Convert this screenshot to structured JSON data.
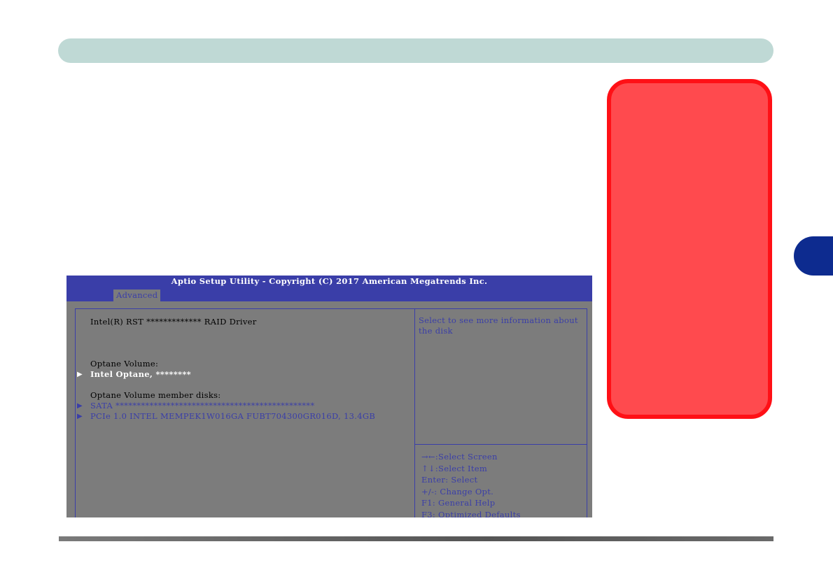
{
  "bios": {
    "title": "Aptio Setup Utility - Copyright (C) 2017 American Megatrends Inc.",
    "active_tab": "Advanced",
    "driver_label": "Intel(R) RST ************* RAID Driver",
    "optane_volume_heading": "Optane Volume:",
    "optane_volume_item": "Intel Optane, ********",
    "member_disks_heading": "Optane Volume member disks:",
    "disk_sata": "SATA ***********************************************",
    "disk_pcie": "PCIe 1.0 INTEL MEMPEK1W016GA FUBT704300GR016D, 13.4GB",
    "arrow_glyph": "▶",
    "help_text": "Select to see more information about the disk",
    "key_help": [
      ":Select Screen",
      ":Select Item",
      "Enter: Select",
      "+/-: Change Opt.",
      "F1: General Help",
      "F3: Optimized Defaults"
    ],
    "key_glyphs": [
      "→←",
      "↑↓"
    ]
  },
  "colors": {
    "header_bar": "#bfd9d5",
    "note_box_fill": "#ff4a4e",
    "note_box_border": "#ff1016",
    "chapter_tab": "#0d2b8f",
    "bios_blue": "#3a3ea8",
    "bios_grey": "#7c7c7c"
  }
}
